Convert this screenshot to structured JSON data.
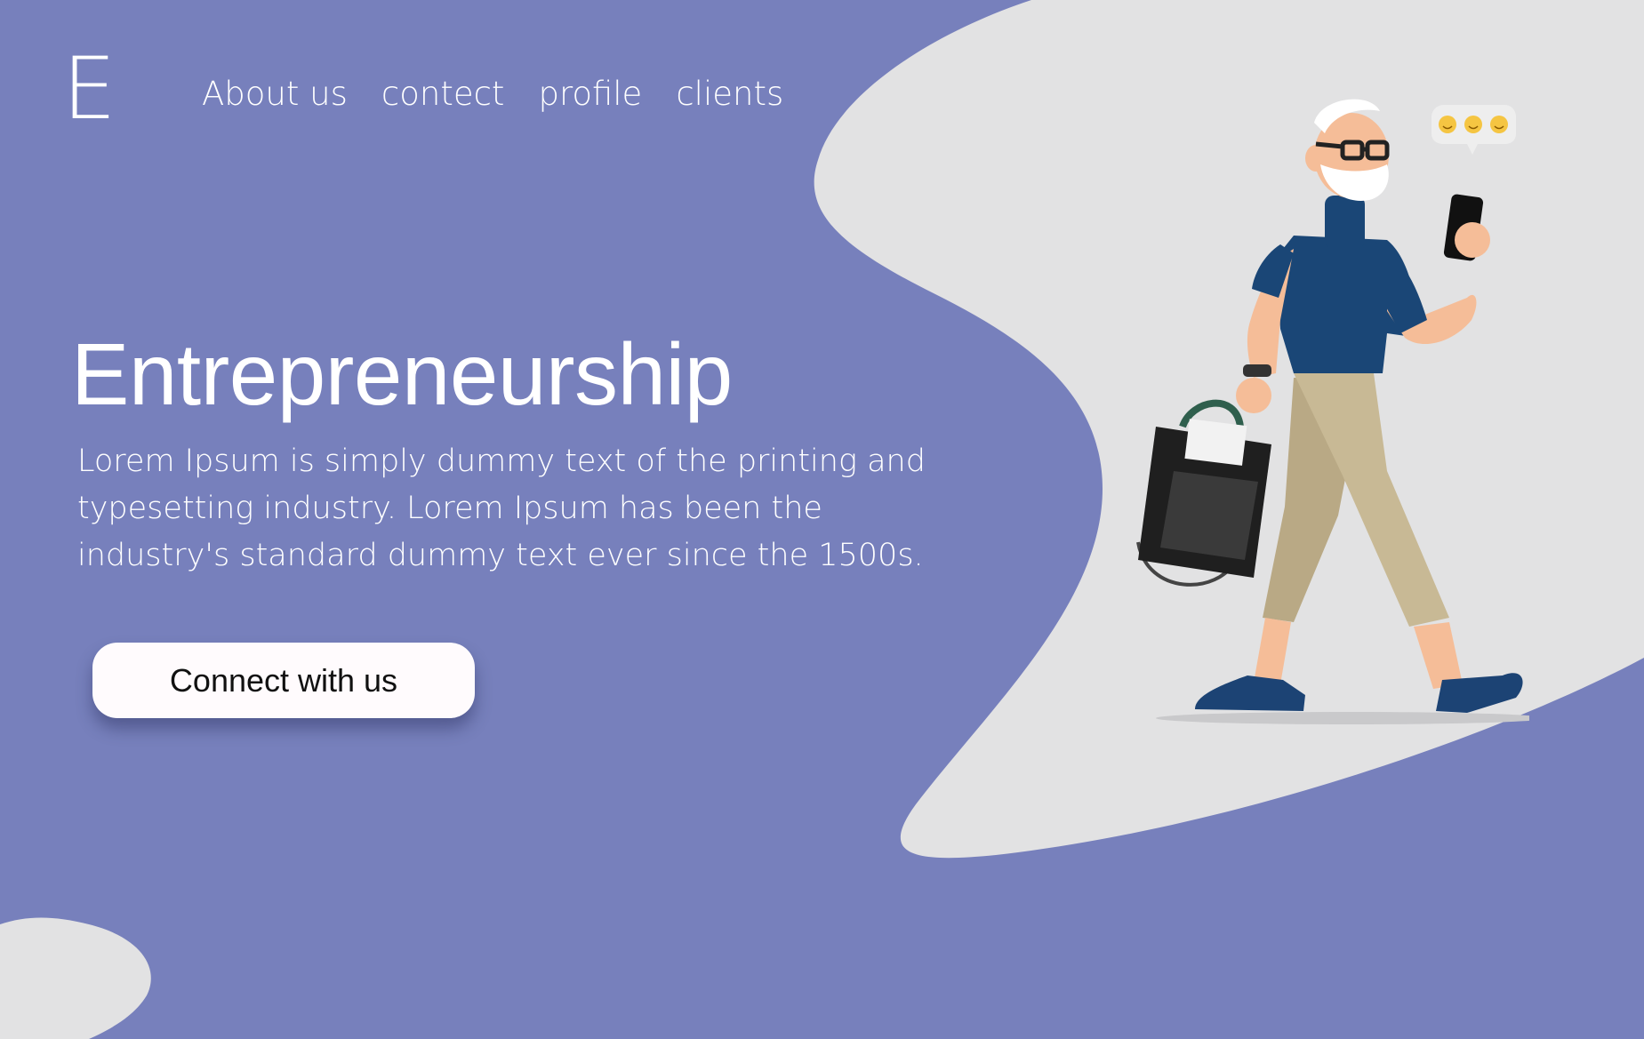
{
  "logo": {
    "letter": "E"
  },
  "nav": {
    "items": [
      {
        "label": "About us"
      },
      {
        "label": "contect"
      },
      {
        "label": "profile"
      },
      {
        "label": "clients"
      }
    ]
  },
  "hero": {
    "title": "Entrepreneurship",
    "description": "Lorem Ipsum is simply dummy text of the printing and typesetting industry. Lorem Ipsum has been the industry's standard dummy text ever since the 1500s.",
    "cta_label": "Connect with us"
  },
  "illustration": {
    "subject": "walking-man-with-phone-and-bag",
    "icons": [
      "smiley-icon",
      "smiley-icon",
      "smiley-icon"
    ]
  },
  "colors": {
    "background": "#7780bc",
    "blob": "#e2e2e3",
    "text": "#ffffff",
    "button": "#fffbfd"
  }
}
